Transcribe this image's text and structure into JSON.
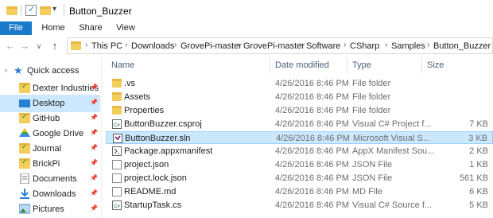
{
  "window": {
    "title": "Button_Buzzer"
  },
  "ribbon": {
    "tabs": [
      "File",
      "Home",
      "Share",
      "View"
    ]
  },
  "address": {
    "crumbs": [
      "This PC",
      "Downloads",
      "GrovePi-master",
      "GrovePi-master",
      "Software",
      "CSharp",
      "Samples",
      "Button_Buzzer"
    ]
  },
  "nav": {
    "quick_access": "Quick access",
    "items": [
      {
        "label": "Dexter Industries",
        "icon": "folder-check-icon",
        "pinned": true
      },
      {
        "label": "Desktop",
        "icon": "desktop-icon",
        "pinned": true,
        "selected": true
      },
      {
        "label": "GitHub",
        "icon": "folder-check-icon",
        "pinned": true
      },
      {
        "label": "Google Drive",
        "icon": "google-drive-icon",
        "pinned": true
      },
      {
        "label": "Journal",
        "icon": "folder-check-icon",
        "pinned": true
      },
      {
        "label": "BrickPi",
        "icon": "folder-check-icon",
        "pinned": true
      },
      {
        "label": "Documents",
        "icon": "documents-icon",
        "pinned": true
      },
      {
        "label": "Downloads",
        "icon": "downloads-icon",
        "pinned": true
      },
      {
        "label": "Pictures",
        "icon": "pictures-icon",
        "pinned": true
      }
    ]
  },
  "columns": {
    "name": "Name",
    "date": "Date modified",
    "type": "Type",
    "size": "Size"
  },
  "files": [
    {
      "name": ".vs",
      "date": "4/26/2016 8:46 PM",
      "type": "File folder",
      "size": "",
      "icon": "folder-icon"
    },
    {
      "name": "Assets",
      "date": "4/26/2016 8:46 PM",
      "type": "File folder",
      "size": "",
      "icon": "folder-icon"
    },
    {
      "name": "Properties",
      "date": "4/26/2016 8:46 PM",
      "type": "File folder",
      "size": "",
      "icon": "folder-icon"
    },
    {
      "name": "ButtonBuzzer.csproj",
      "date": "4/26/2016 8:46 PM",
      "type": "Visual C# Project f...",
      "size": "7 KB",
      "icon": "csproj-icon"
    },
    {
      "name": "ButtonBuzzer.sln",
      "date": "4/26/2016 8:46 PM",
      "type": "Microsoft Visual S...",
      "size": "3 KB",
      "icon": "sln-icon",
      "selected": true
    },
    {
      "name": "Package.appxmanifest",
      "date": "4/26/2016 8:46 PM",
      "type": "AppX Manifest Sou...",
      "size": "2 KB",
      "icon": "manifest-icon"
    },
    {
      "name": "project.json",
      "date": "4/26/2016 8:46 PM",
      "type": "JSON File",
      "size": "1 KB",
      "icon": "file-icon"
    },
    {
      "name": "project.lock.json",
      "date": "4/26/2016 8:46 PM",
      "type": "JSON File",
      "size": "561 KB",
      "icon": "file-icon"
    },
    {
      "name": "README.md",
      "date": "4/26/2016 8:46 PM",
      "type": "MD File",
      "size": "6 KB",
      "icon": "file-icon"
    },
    {
      "name": "StartupTask.cs",
      "date": "4/26/2016 8:46 PM",
      "type": "Visual C# Source f...",
      "size": "5 KB",
      "icon": "cs-file-icon"
    }
  ],
  "colors": {
    "file_tab": "#1979ca",
    "selection": "#cce8ff",
    "folder": "#f4ce5c"
  }
}
